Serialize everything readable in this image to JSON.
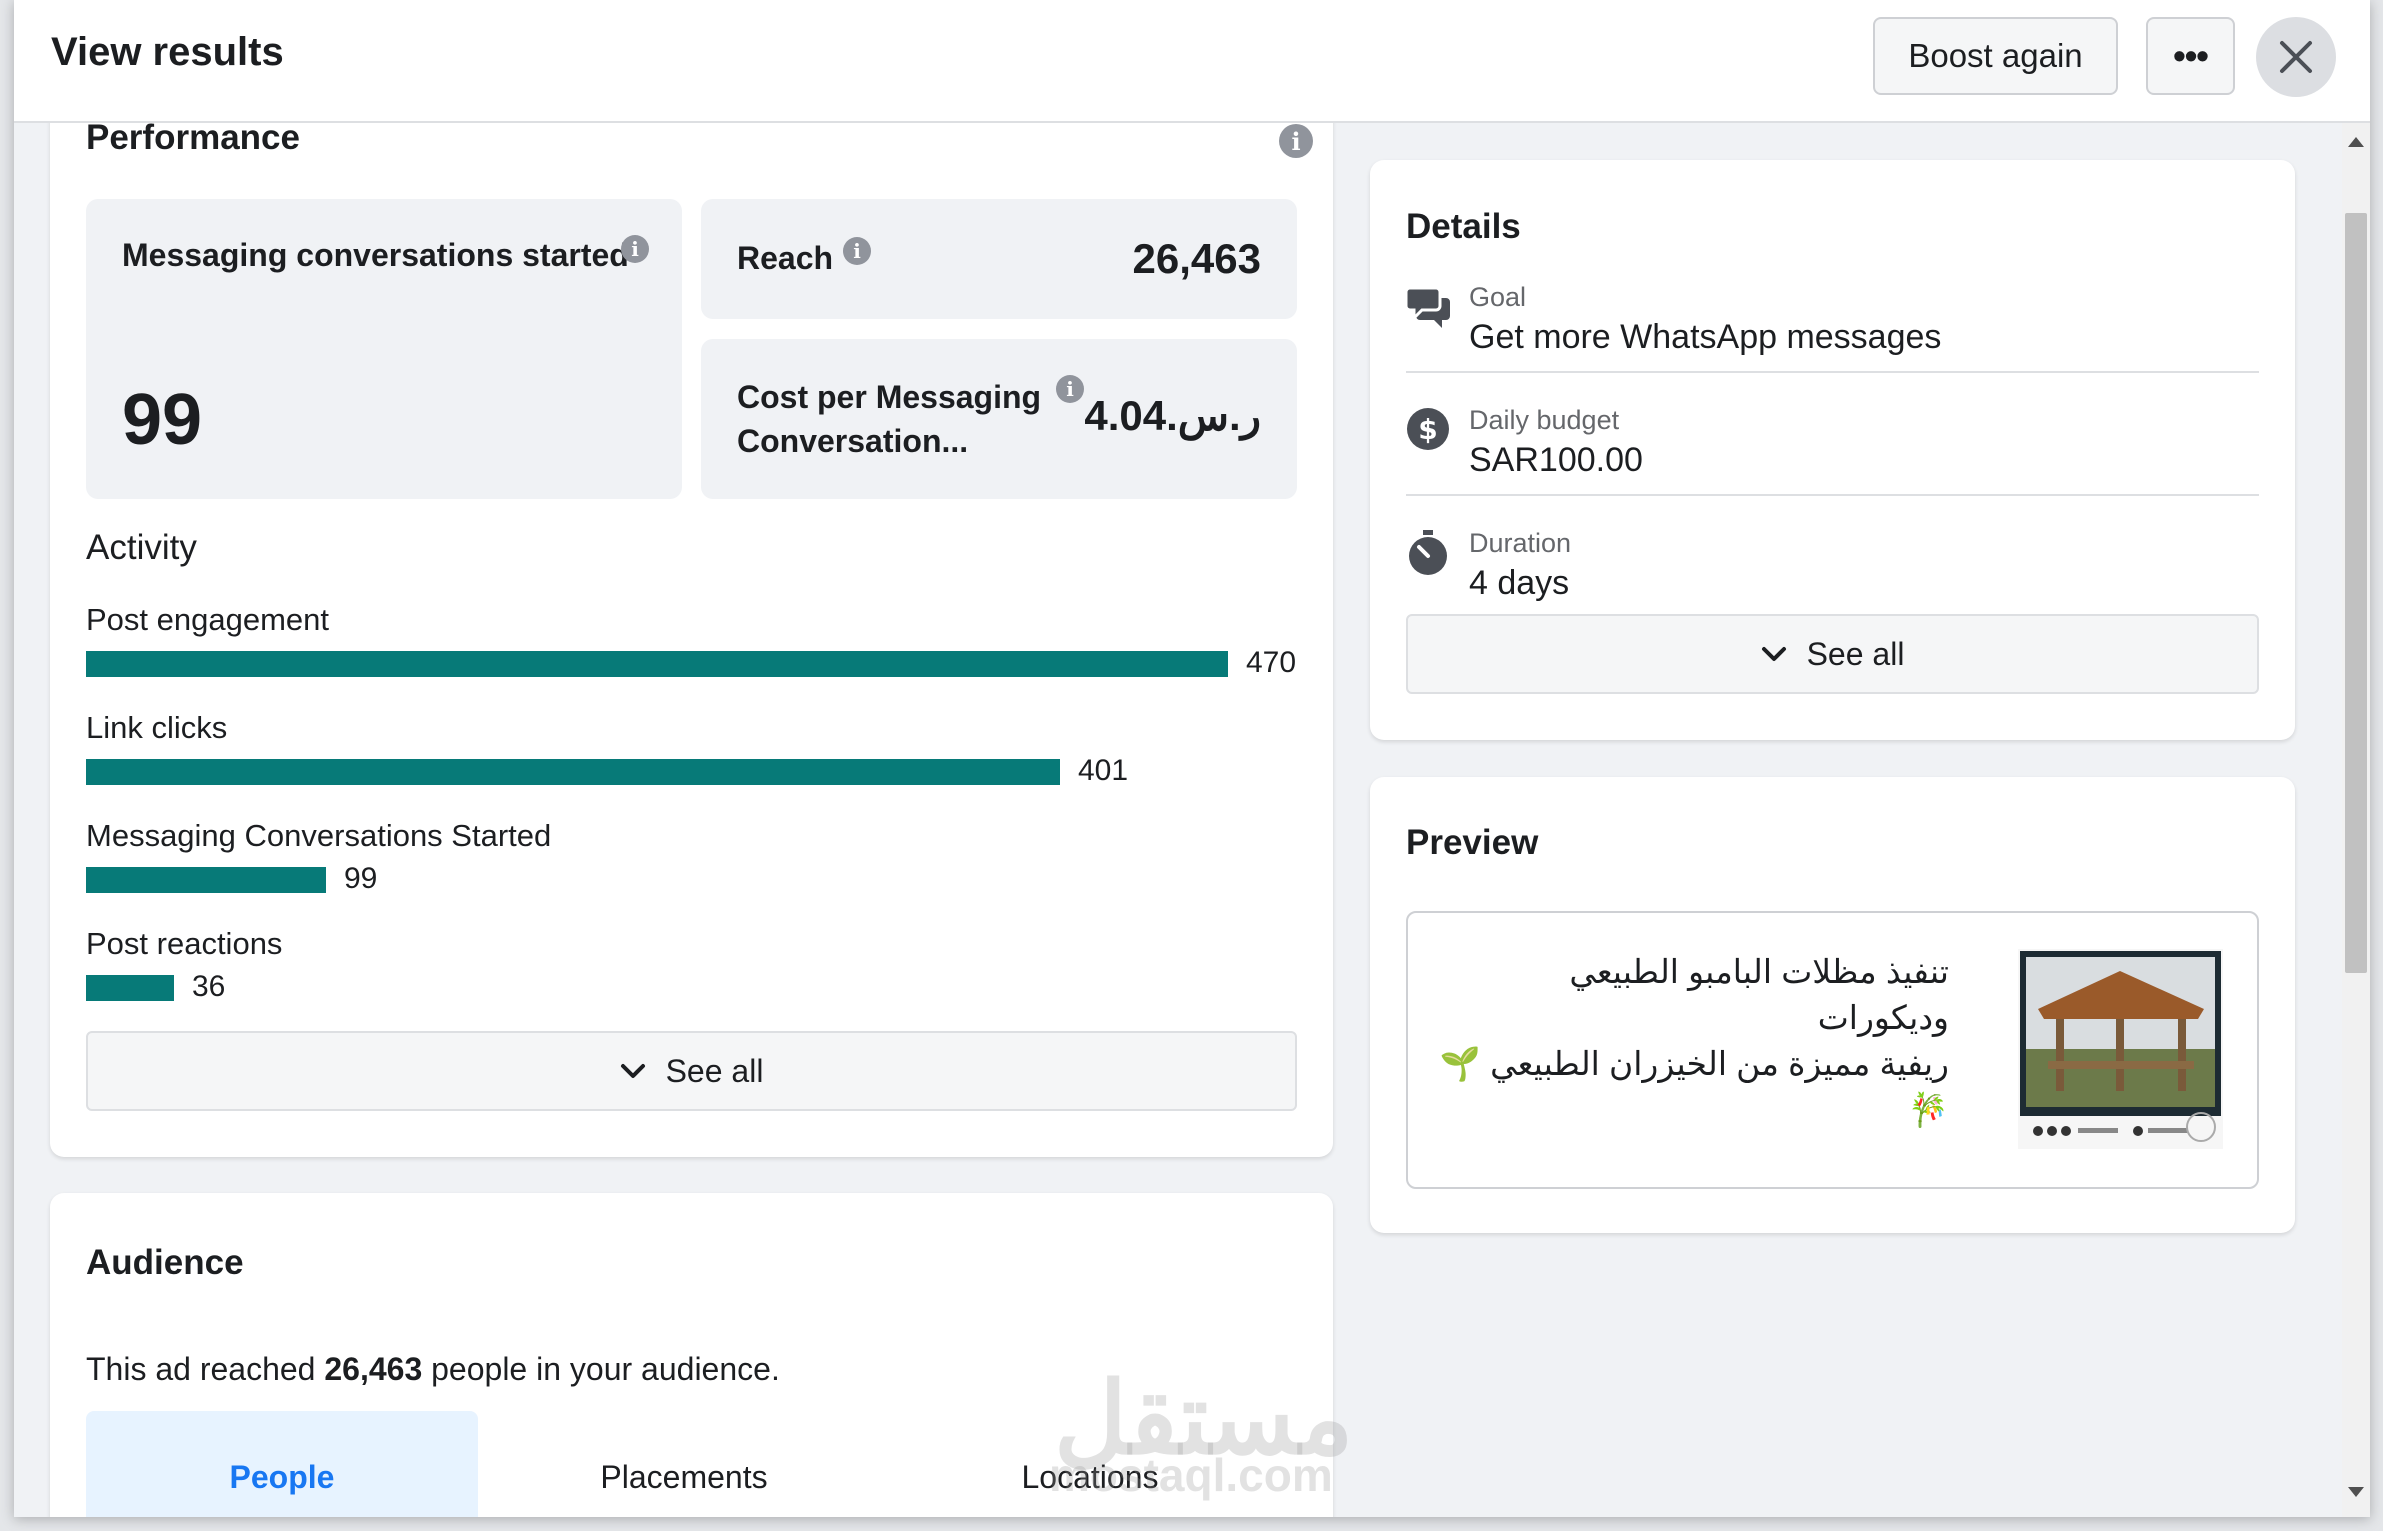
{
  "header": {
    "title": "View results",
    "boost_label": "Boost again",
    "more_label": "•••"
  },
  "performance": {
    "title": "Performance",
    "metrics": {
      "messaging": {
        "label": "Messaging conversations started",
        "value": "99"
      },
      "reach": {
        "label": "Reach",
        "value": "26,463"
      },
      "cost": {
        "label_line1": "Cost per Messaging",
        "label_line2": "Conversation...",
        "value": "4.04.ر.س"
      }
    },
    "activity_title": "Activity",
    "activity": [
      {
        "label": "Post engagement",
        "value": "470",
        "fraction": 1.0
      },
      {
        "label": "Link clicks",
        "value": "401",
        "fraction": 0.853
      },
      {
        "label": "Messaging Conversations Started",
        "value": "99",
        "fraction": 0.21
      },
      {
        "label": "Post reactions",
        "value": "36",
        "fraction": 0.077
      }
    ],
    "see_all": "See all"
  },
  "audience": {
    "title": "Audience",
    "reach_prefix": "This ad reached ",
    "reach_count": "26,463",
    "reach_suffix": " people in your audience.",
    "tabs": [
      "People",
      "Placements",
      "Locations"
    ]
  },
  "details": {
    "title": "Details",
    "goal_label": "Goal",
    "goal_value": "Get more WhatsApp messages",
    "budget_label": "Daily budget",
    "budget_value": "SAR100.00",
    "duration_label": "Duration",
    "duration_value": "4 days",
    "see_all": "See all"
  },
  "preview": {
    "title": "Preview",
    "text_line1": "تنفيذ مظلات البامبو الطبيعي وديكورات",
    "text_line2": "ريفية مميزة من الخيزران الطبيعي 🌱🎋"
  },
  "watermark": {
    "main": "مستقل",
    "sub": "mostaql.com"
  },
  "colors": {
    "bar": "#077a78",
    "tab_active_bg": "#e7f3ff",
    "tab_active_text": "#1877f2"
  }
}
